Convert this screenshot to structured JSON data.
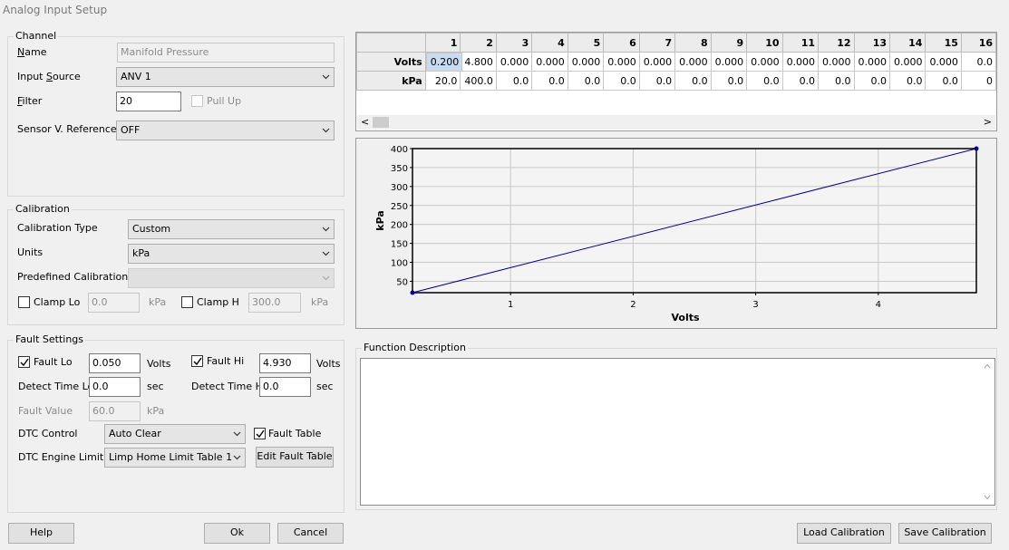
{
  "window": {
    "title": "Analog Input Setup"
  },
  "channel": {
    "group_title": "Channel",
    "name_label": "Name",
    "name_value": "Manifold Pressure",
    "input_source_label": "Input Source",
    "input_source_value": "ANV 1",
    "filter_label": "Filter",
    "filter_value": "20",
    "pull_up_label": "Pull Up",
    "sensor_ref_label": "Sensor V. Reference",
    "sensor_ref_value": "OFF"
  },
  "calibration": {
    "group_title": "Calibration",
    "type_label": "Calibration Type",
    "type_value": "Custom",
    "units_label": "Units",
    "units_value": "kPa",
    "predefined_label": "Predefined Calibration",
    "predefined_value": "",
    "clamp_lo_label": "Clamp Lo",
    "clamp_lo_value": "0.0",
    "clamp_lo_unit": "kPa",
    "clamp_hi_label": "Clamp H",
    "clamp_hi_value": "300.0",
    "clamp_hi_unit": "kPa"
  },
  "fault": {
    "group_title": "Fault Settings",
    "fault_lo_label": "Fault Lo",
    "fault_lo_value": "0.050",
    "fault_lo_unit": "Volts",
    "fault_hi_label": "Fault Hi",
    "fault_hi_value": "4.930",
    "fault_hi_unit": "Volts",
    "detect_lo_label": "Detect Time Lo",
    "detect_lo_value": "0.0",
    "detect_lo_unit": "sec",
    "detect_hi_label": "Detect Time Hi",
    "detect_hi_value": "0.0",
    "detect_hi_unit": "sec",
    "fault_value_label": "Fault Value",
    "fault_value_value": "60.0",
    "fault_value_unit": "kPa",
    "dtc_control_label": "DTC Control",
    "dtc_control_value": "Auto Clear",
    "fault_table_label": "Fault Table",
    "dtc_limit_label": "DTC Engine Limit",
    "dtc_limit_value": "Limp Home Limit Table 1",
    "edit_fault_table_label": "Edit Fault Table"
  },
  "table": {
    "columns": [
      "1",
      "2",
      "3",
      "4",
      "5",
      "6",
      "7",
      "8",
      "9",
      "10",
      "11",
      "12",
      "13",
      "14",
      "15",
      "16"
    ],
    "rows": [
      {
        "label": "Volts",
        "values": [
          "0.200",
          "4.800",
          "0.000",
          "0.000",
          "0.000",
          "0.000",
          "0.000",
          "0.000",
          "0.000",
          "0.000",
          "0.000",
          "0.000",
          "0.000",
          "0.000",
          "0.000",
          "0.0"
        ]
      },
      {
        "label": "kPa",
        "values": [
          "20.0",
          "400.0",
          "0.0",
          "0.0",
          "0.0",
          "0.0",
          "0.0",
          "0.0",
          "0.0",
          "0.0",
          "0.0",
          "0.0",
          "0.0",
          "0.0",
          "0.0",
          "0"
        ]
      }
    ],
    "scroll_left": "<",
    "scroll_right": ">"
  },
  "chart_data": {
    "type": "line",
    "xlabel": "Volts",
    "ylabel": "kPa",
    "xlim": [
      0.2,
      4.8
    ],
    "ylim": [
      20,
      400
    ],
    "xticks": [
      1,
      2,
      3,
      4
    ],
    "yticks": [
      50,
      100,
      150,
      200,
      250,
      300,
      350,
      400
    ],
    "grid": true,
    "series": [
      {
        "x": [
          0.2,
          4.8
        ],
        "y": [
          20,
          400
        ],
        "color": "#0000a0"
      }
    ]
  },
  "description": {
    "group_title": "Function Description",
    "text": ""
  },
  "buttons": {
    "help": "Help",
    "ok": "Ok",
    "cancel": "Cancel",
    "load": "Load Calibration",
    "save": "Save Calibration"
  }
}
